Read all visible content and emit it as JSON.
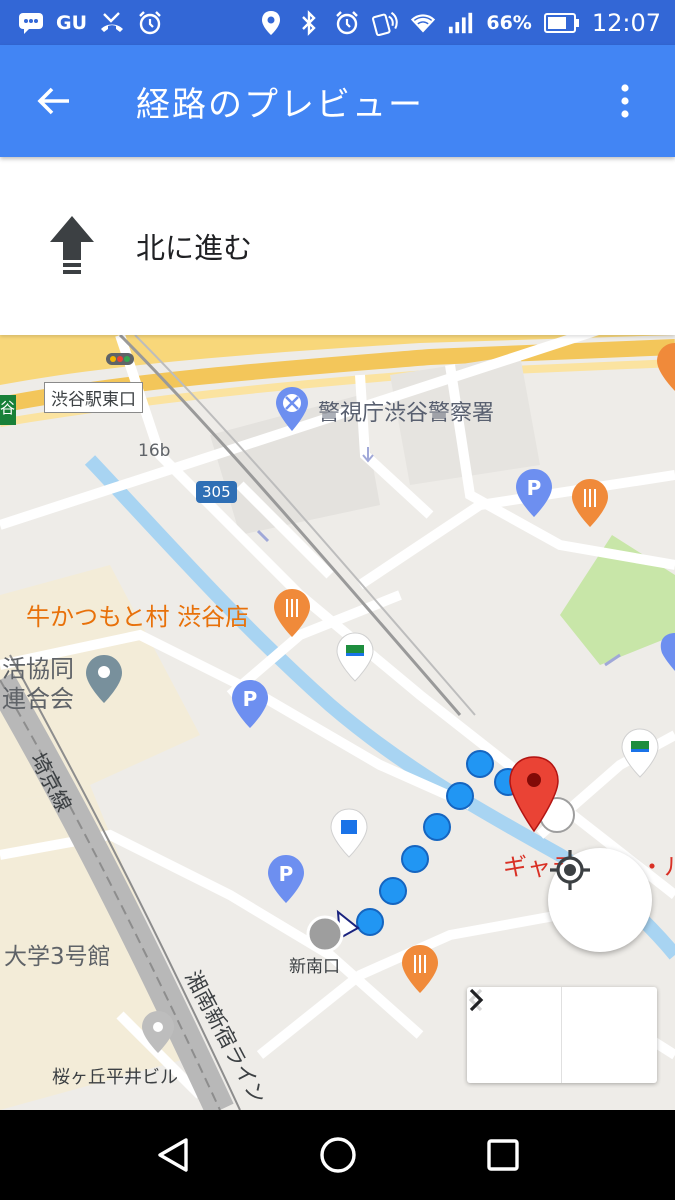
{
  "status_bar": {
    "carrier": "GU",
    "battery": "66%",
    "time": "12:07",
    "icons": [
      "message-icon",
      "missed-call-icon",
      "alarm-icon",
      "location-icon",
      "bluetooth-icon",
      "alarm-icon",
      "nfc-icon",
      "wifi-icon",
      "signal-icon",
      "battery-icon"
    ]
  },
  "app_bar": {
    "title": "経路のプレビュー",
    "back_icon": "arrow-back-icon",
    "menu_icon": "more-vert-icon"
  },
  "direction": {
    "instruction": "北に進む",
    "icon": "arrow-up-icon"
  },
  "map": {
    "labels": {
      "station_exit": "渋谷駅東口",
      "road_code": "16b",
      "route_number": "305",
      "police": "警視庁渋谷警察署",
      "restaurant": "牛かつもと村 渋谷店",
      "coop_line1": "活協同",
      "coop_line2": "連合会",
      "railway_saikyo": "埼京線",
      "railway_shonan": "湘南新宿ライン",
      "university": "大学3号館",
      "building": "桜ヶ丘平井ビル",
      "exit_south": "新南口",
      "destination": "ギャラ",
      "destination_tail": "・ル",
      "edge_label": "谷"
    },
    "colors": {
      "route": "#2196f3",
      "destination_pin": "#ea4335",
      "poi_blue": "#6d8ff0",
      "poi_orange": "#f08a3a",
      "water": "#a8d4f2",
      "park": "#c8e6a8",
      "highway": "#f8d77a"
    }
  },
  "controls": {
    "locate_icon": "my-location-icon",
    "prev_icon": "chevron-left-icon",
    "next_icon": "chevron-right-icon"
  },
  "nav_bar": {
    "icons": [
      "back-triangle-icon",
      "home-circle-icon",
      "recents-square-icon"
    ]
  }
}
